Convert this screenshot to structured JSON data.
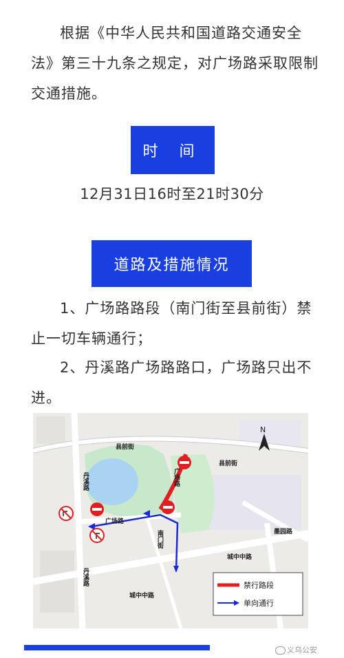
{
  "intro": "根据《中华人民共和国道路交通安全法》第三十九条之规定，对广场路采取限制交通措施。",
  "time_section": {
    "badge": "时 间",
    "text": "12月31日16时至21时30分"
  },
  "road_section": {
    "badge": "道路及措施情况",
    "measures": [
      "1、广场路路段（南门街至县前街）禁止一切车辆通行；",
      "2、丹溪路广场路路口，广场路只出不进。"
    ]
  },
  "map": {
    "labels": {
      "xianqianjie_top": "县前街",
      "xianqianjie_right": "县前街",
      "danxilu_top": "丹溪路",
      "danxilu_bottom": "丹溪路",
      "guangchanglu_vertical": "广场路",
      "guangchanglu_horizontal": "广场路",
      "nanmenjie": "南门街",
      "chengzhongzhonglu_left": "城中中路",
      "chengzhongzhonglu_right": "城中中路",
      "huangyuanlu": "墨园路"
    },
    "compass": "N",
    "legend": [
      {
        "label": "禁行路段",
        "color": "#e02020"
      },
      {
        "label": "单向通行",
        "color": "#1a2ad0"
      }
    ]
  },
  "watermark": "义乌公安",
  "colors": {
    "accent": "#1a3fe0",
    "closed": "#e02020",
    "oneway": "#1a2ad0"
  }
}
